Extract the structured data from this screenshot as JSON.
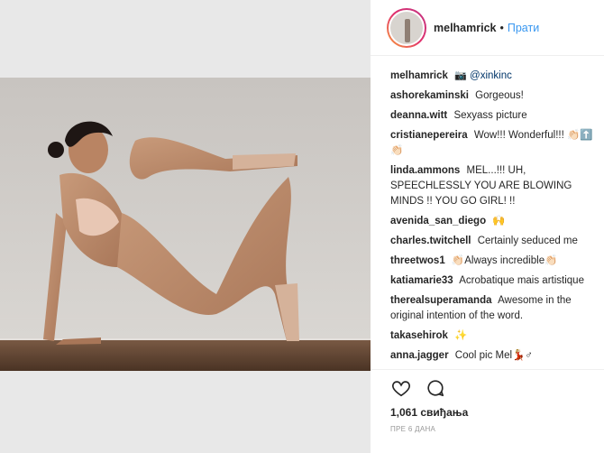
{
  "post": {
    "author": "melhamrick",
    "separator": "•",
    "follow_label": "Прати",
    "caption_user": "melhamrick",
    "caption_icon": "📷",
    "caption_mention": "@xinkinc"
  },
  "comments": [
    {
      "user": "ashorekaminski",
      "text": "Gorgeous!"
    },
    {
      "user": "deanna.witt",
      "text": "Sexyass picture"
    },
    {
      "user": "cristianepereira",
      "text": "Wow!!! Wonderful!!! 👏🏻⬆️👏🏻"
    },
    {
      "user": "linda.ammons",
      "text": "MEL...!!! UH, SPEECHLESSLY YOU ARE BLOWING MINDS !! YOU GO GIRL! !!"
    },
    {
      "user": "avenida_san_diego",
      "text": "🙌"
    },
    {
      "user": "charles.twitchell",
      "text": "Certainly seduced me"
    },
    {
      "user": "threetwos1",
      "text": "👏🏻Always incredible👏🏻"
    },
    {
      "user": "katiamarie33",
      "text": "Acrobatique mais artistique"
    },
    {
      "user": "therealsuperamanda",
      "text": "Awesome in the original intention of the word."
    },
    {
      "user": "takasehirok",
      "text": "✨"
    },
    {
      "user": "anna.jagger",
      "text": "Cool pic Mel💃🏼♂"
    },
    {
      "user": "",
      "text": ""
    }
  ],
  "stats": {
    "likes": "1,061 свиђања",
    "time": "ПРЕ 6 ДАНА"
  },
  "icons": [
    "heart-icon",
    "comment-icon"
  ],
  "colors": {
    "link": "#3897f0",
    "text": "#262626",
    "muted": "#999999"
  }
}
